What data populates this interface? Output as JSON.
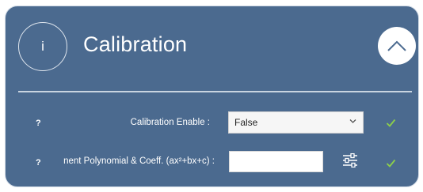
{
  "header": {
    "info_glyph": "i",
    "title": "Calibration",
    "collapse_icon": "chevron-up-icon"
  },
  "rows": [
    {
      "help": "?",
      "label": "Calibration Enable :",
      "control": "select",
      "value": "False",
      "status_icon": "checkmark-icon"
    },
    {
      "help": "?",
      "label": "nent Polynomial & Coeff. (ax²+bx+c) :",
      "control": "text-input",
      "value": "",
      "action_icon": "sliders-settings-icon",
      "status_icon": "checkmark-icon"
    }
  ],
  "colors": {
    "panel_bg": "#4b6a8f",
    "check_green": "#8ccf4a",
    "border": "#d2dbe6"
  }
}
